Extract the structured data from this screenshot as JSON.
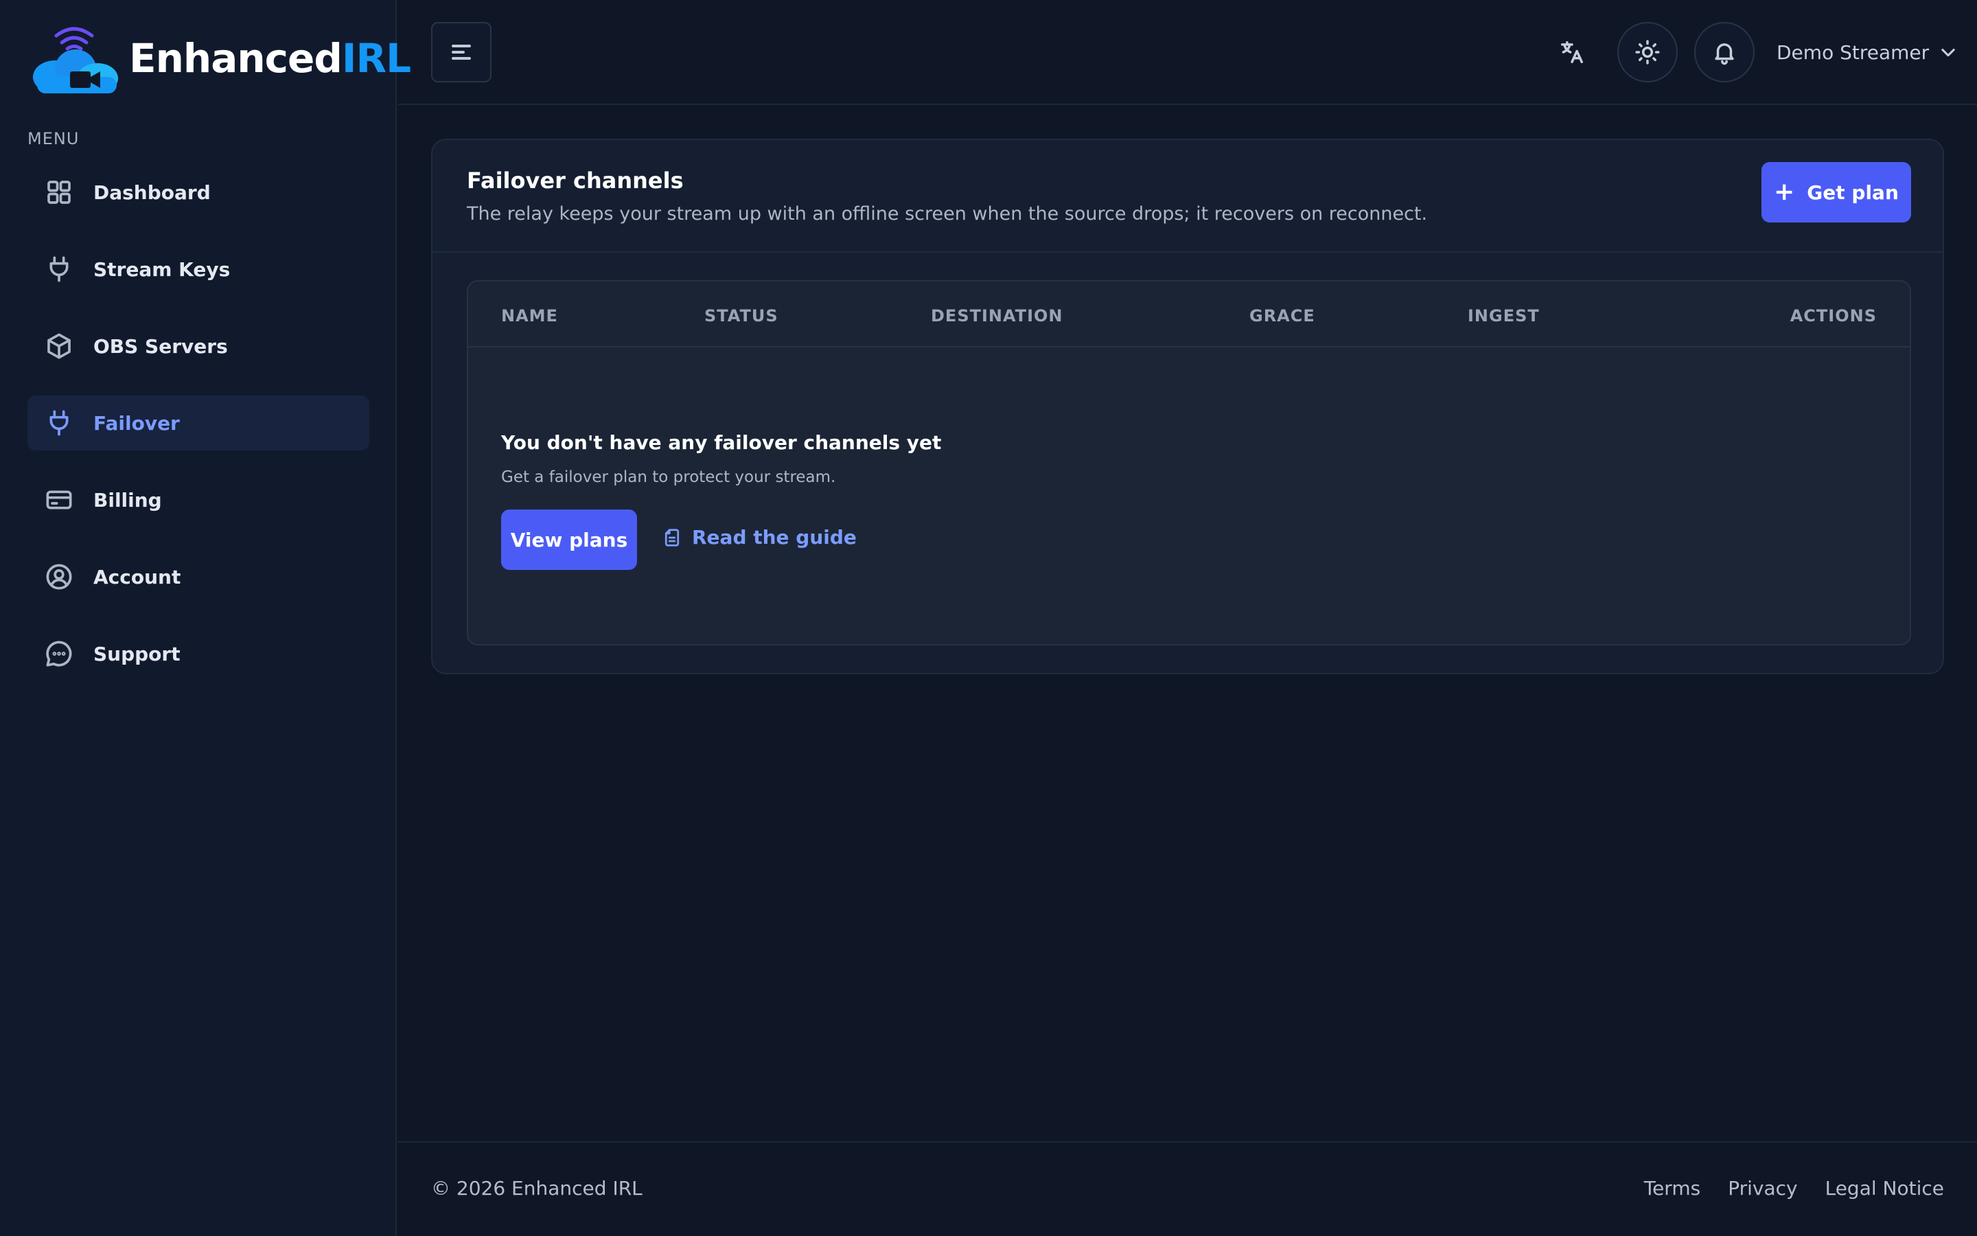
{
  "brand": {
    "name_part1": "Enhanced",
    "name_part2": "IRL",
    "colors": {
      "cloud": "#1597f5",
      "waves": "#6a4df5",
      "camera": "#0f1727"
    }
  },
  "sidebar": {
    "menu_label": "MENU",
    "items": [
      {
        "label": "Dashboard",
        "icon": "grid-icon",
        "active": false
      },
      {
        "label": "Stream Keys",
        "icon": "plug-icon",
        "active": false
      },
      {
        "label": "OBS Servers",
        "icon": "cube-icon",
        "active": false
      },
      {
        "label": "Failover",
        "icon": "plug-icon",
        "active": true
      },
      {
        "label": "Billing",
        "icon": "credit-card-icon",
        "active": false
      },
      {
        "label": "Account",
        "icon": "user-circle-icon",
        "active": false
      },
      {
        "label": "Support",
        "icon": "chat-bubble-icon",
        "active": false
      }
    ]
  },
  "header": {
    "user_name": "Demo Streamer",
    "icons": [
      "menu-icon",
      "translate-icon",
      "sun-icon",
      "bell-icon",
      "chevron-down-icon"
    ]
  },
  "card": {
    "title": "Failover channels",
    "subtitle": "The relay keeps your stream up with an offline screen when the source drops; it recovers on reconnect.",
    "get_plan_label": "Get plan",
    "plus": "+",
    "columns": [
      "NAME",
      "STATUS",
      "DESTINATION",
      "GRACE",
      "INGEST",
      "ACTIONS"
    ],
    "empty": {
      "title": "You don't have any failover channels yet",
      "subtitle": "Get a failover plan to protect your stream.",
      "view_plans_label": "View plans",
      "guide_label": "Read the guide"
    }
  },
  "footer": {
    "copyright": "© 2026 Enhanced IRL",
    "links": [
      "Terms",
      "Privacy",
      "Legal Notice"
    ]
  },
  "theme": {
    "accent": "#4b5cf6",
    "active_text": "#7b9cff",
    "background": "#0f1727"
  }
}
